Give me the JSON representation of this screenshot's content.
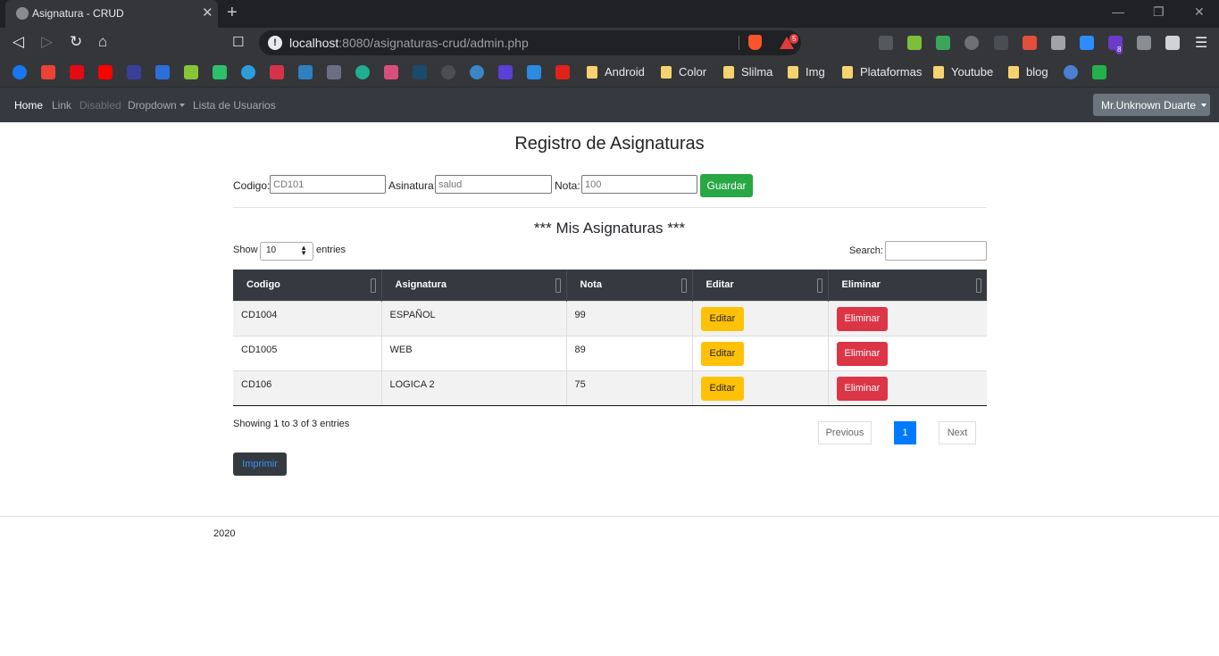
{
  "browser": {
    "tab_title": "Asignatura - CRUD",
    "url_host": "localhost",
    "url_rest": ":8080/asignaturas-crud/admin.php",
    "reward_badge": "5",
    "ext_badge": "8",
    "bookmark_folders": [
      "Android",
      "Color",
      "Slilma",
      "Img",
      "Plataformas",
      "Youtube",
      "blog"
    ]
  },
  "navbar": {
    "home": "Home",
    "link": "Link",
    "disabled": "Disabled",
    "dropdown": "Dropdown",
    "users": "Lista de Usuarios",
    "user_menu": "Mr.Unknown Duarte"
  },
  "page": {
    "title": "Registro de Asignaturas",
    "subtitle": "*** Mis Asignaturas ***"
  },
  "form": {
    "codigo_label": "Codigo:",
    "codigo_placeholder": "CD101",
    "asignatura_label": "Asinatura:",
    "asignatura_placeholder": "salud",
    "nota_label": "Nota:",
    "nota_placeholder": "100",
    "save_label": "Guardar"
  },
  "table_controls": {
    "show": "Show",
    "entries_value": "10",
    "entries": "entries",
    "search": "Search:"
  },
  "table": {
    "headers": [
      "Codigo",
      "Asignatura",
      "Nota",
      "Editar",
      "Eliminar"
    ],
    "edit_label": "Editar",
    "delete_label": "Eliminar",
    "rows": [
      {
        "codigo": "CD1004",
        "asignatura": "ESPAÑOL",
        "nota": "99"
      },
      {
        "codigo": "CD1005",
        "asignatura": "WEB",
        "nota": "89"
      },
      {
        "codigo": "CD106",
        "asignatura": "LOGICA 2",
        "nota": "75"
      }
    ]
  },
  "pagination": {
    "info": "Showing 1 to 3 of 3 entries",
    "previous": "Previous",
    "current": "1",
    "next": "Next"
  },
  "print_label": "Imprimir",
  "footer": {
    "year": "2020"
  }
}
